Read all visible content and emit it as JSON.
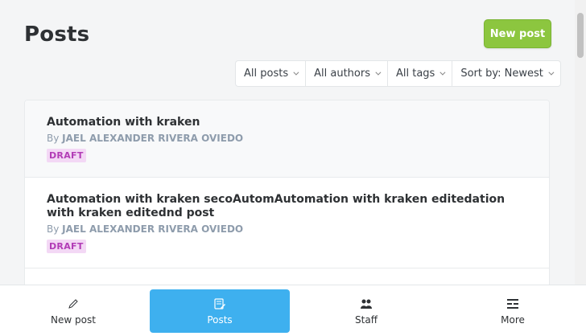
{
  "header": {
    "title": "Posts",
    "new_post_label": "New post"
  },
  "filters": [
    {
      "label": "All posts"
    },
    {
      "label": "All authors"
    },
    {
      "label": "All tags"
    },
    {
      "label": "Sort by: Newest"
    }
  ],
  "posts": [
    {
      "title": "Automation with kraken",
      "by": "By",
      "author": "JAEL ALEXANDER RIVERA OVIEDO",
      "status": "DRAFT"
    },
    {
      "title": "Automation with kraken secoAutomAutomation with kraken editedation with kraken editednd post",
      "by": "By",
      "author": "JAEL ALEXANDER RIVERA OVIEDO",
      "status": "DRAFT"
    }
  ],
  "bottom_nav": [
    {
      "label": "New post",
      "icon": "pencil-icon"
    },
    {
      "label": "Posts",
      "icon": "posts-icon"
    },
    {
      "label": "Staff",
      "icon": "staff-icon"
    },
    {
      "label": "More",
      "icon": "more-icon"
    }
  ],
  "colors": {
    "accent_green": "#8cc63f",
    "accent_blue": "#3eb0ef",
    "draft_bg": "#f3d8f5",
    "draft_text": "#b23cb6"
  }
}
